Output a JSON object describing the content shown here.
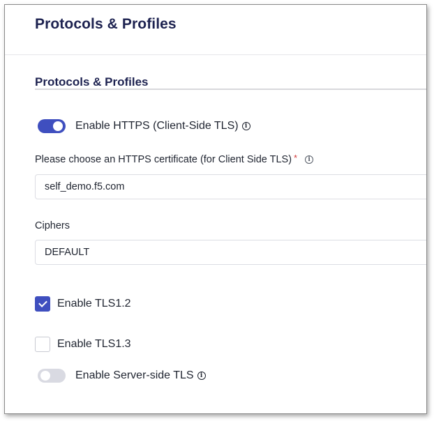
{
  "header": {
    "title": "Protocols & Profiles"
  },
  "section": {
    "title": "Protocols & Profiles"
  },
  "https_toggle": {
    "label": "Enable HTTPS (Client-Side TLS)",
    "state": "on"
  },
  "certificate": {
    "label": "Please choose an HTTPS certificate (for Client Side TLS)",
    "required_mark": "*",
    "value": "self_demo.f5.com"
  },
  "ciphers": {
    "label": "Ciphers",
    "value": "DEFAULT"
  },
  "tls12": {
    "label": "Enable TLS1.2",
    "checked": true
  },
  "tls13": {
    "label": "Enable TLS1.3",
    "checked": false
  },
  "server_tls_toggle": {
    "label": "Enable Server-side TLS",
    "state": "off"
  },
  "icons": {
    "info": "i"
  },
  "colors": {
    "accent": "#3f4fbf",
    "heading": "#1d2250",
    "toggle_off": "#d9dae2",
    "required": "#d13b3b"
  }
}
